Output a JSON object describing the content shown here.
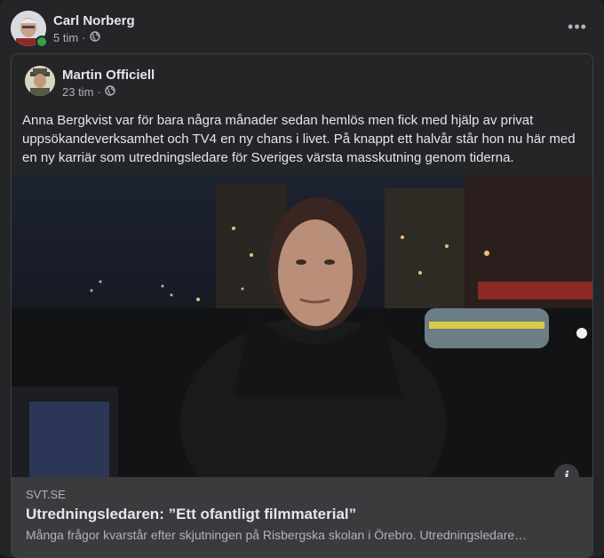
{
  "outer_post": {
    "author": "Carl Norberg",
    "time": "5 tim",
    "separator": "·",
    "audience_icon": "globe-icon",
    "more_icon": "more-horizontal-icon",
    "more_label": "•••"
  },
  "shared_post": {
    "author": "Martin Officiell",
    "time": "23 tim",
    "separator": "·",
    "audience_icon": "globe-icon",
    "text": "Anna Bergkvist var för bara några månader sedan hemlös men fick med hjälp av privat uppsökandeverksamhet och TV4 en ny chans i livet. På knappt ett halvår står hon nu här med en ny karriär som utredningsledare för Sveriges värsta masskutning genom tiderna."
  },
  "link_preview": {
    "domain": "SVT.SE",
    "title": "Utredningsledaren: ”Ett ofantligt filmmaterial”",
    "description": "Många frågor kvarstår efter skjutningen på Risbergska skolan i Örebro. Utredningsledare…",
    "info_label": "i"
  },
  "colors": {
    "background": "#242526",
    "text": "#e4e6eb",
    "secondary_text": "#b0b3b8",
    "online": "#31a24c"
  }
}
